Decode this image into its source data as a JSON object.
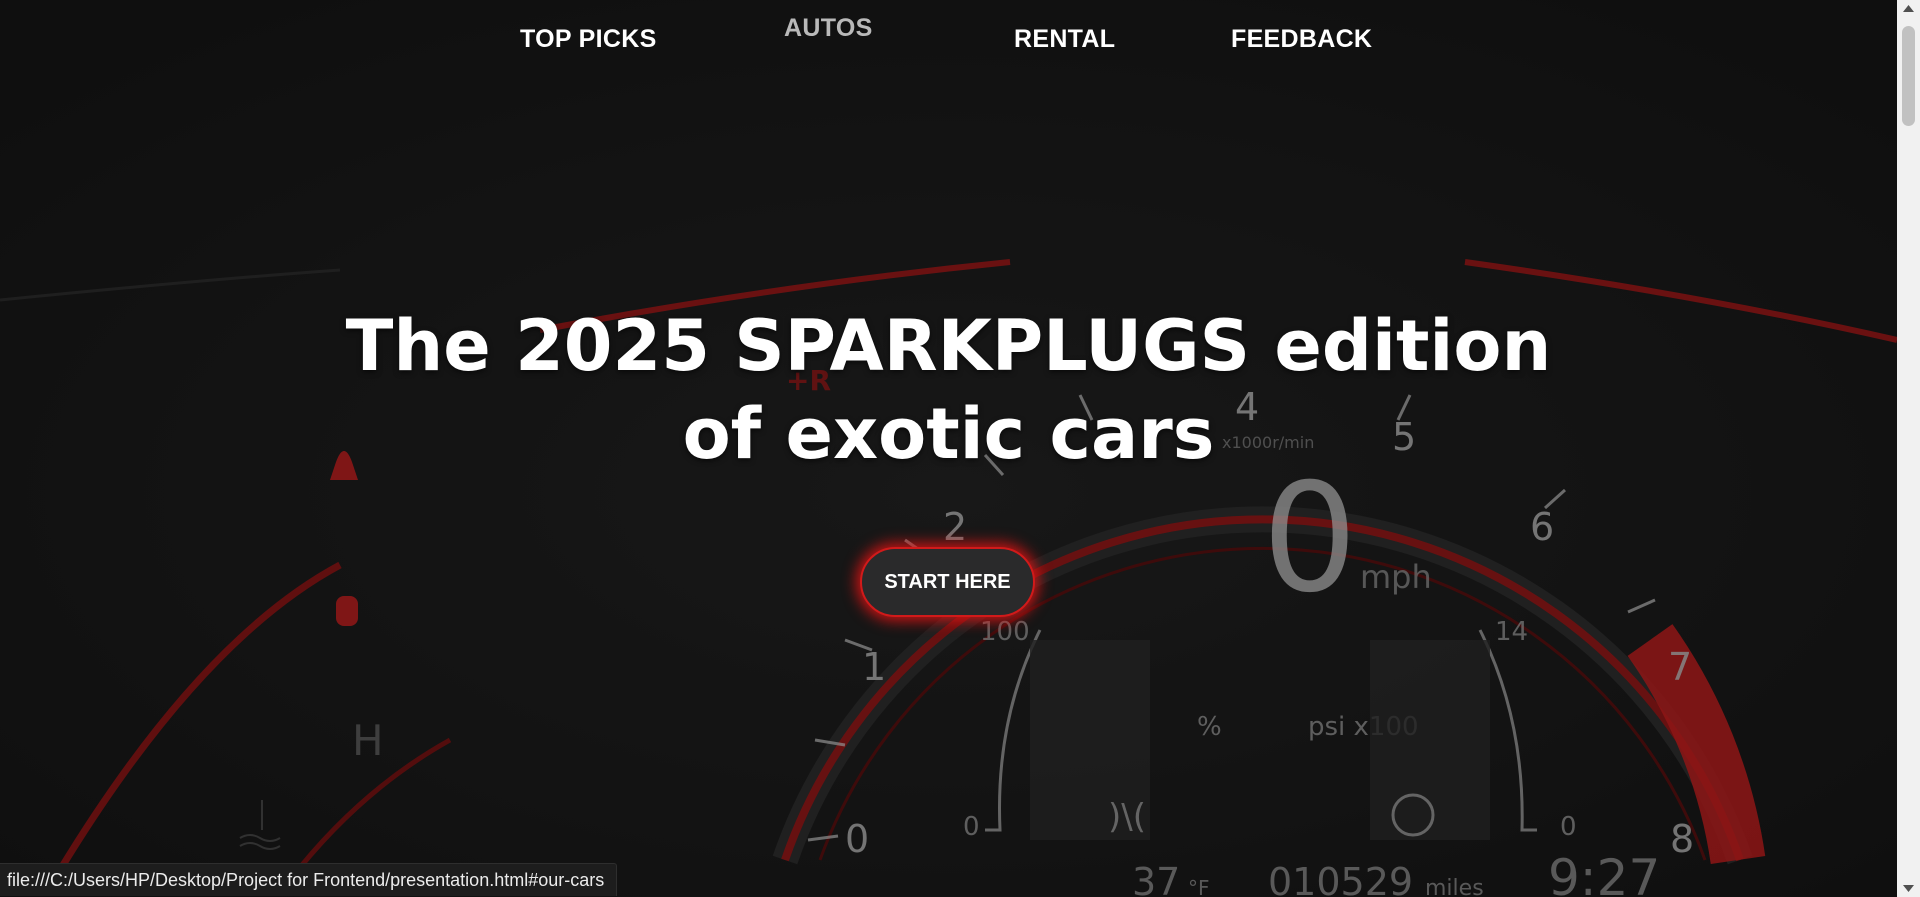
{
  "nav": {
    "items": [
      {
        "label": "TOP PICKS",
        "active": false
      },
      {
        "label": "AUTOS",
        "active": true
      },
      {
        "label": "RENTAL",
        "active": false
      },
      {
        "label": "FEEDBACK",
        "active": false
      }
    ]
  },
  "hero": {
    "headline_line1": "The 2025 SPARKPLUGS edition",
    "headline_line2": "of exotic cars",
    "cta_label": "START HERE",
    "background": {
      "description_icon": "speedometer-dashboard-image",
      "gauge_numbers": [
        "0",
        "1",
        "2",
        "4",
        "5",
        "6",
        "7",
        "8"
      ],
      "speed_value": "0",
      "speed_unit": "mph",
      "rpm_label": "x1000r/min",
      "left_gauge_top": "100",
      "left_gauge_bottom": "0",
      "left_gauge_unit": "%",
      "right_gauge_top": "14",
      "right_gauge_bottom": "0",
      "right_gauge_unit": "psi x100",
      "temp": "37 °F",
      "odometer": "010529",
      "odometer_unit": "miles",
      "clock": "9:27",
      "temp_gauge_label": "H",
      "brand_mark": "+R"
    }
  },
  "status_bar": {
    "url": "file:///C:/Users/HP/Desktop/Project for Frontend/presentation.html#our-cars"
  },
  "colors": {
    "background": "#141414",
    "accent_red": "#d11a1a",
    "text": "#ffffff",
    "active_nav": "#b9b9b9"
  }
}
